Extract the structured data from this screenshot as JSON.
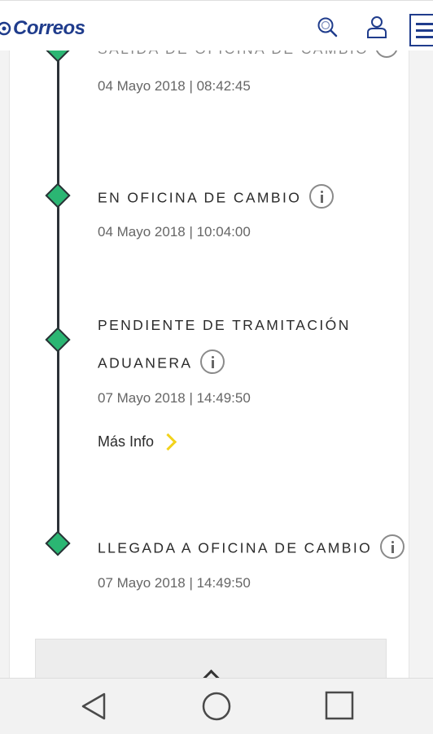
{
  "header": {
    "brand": "Correos",
    "brand_color": "#1f3c8c",
    "icons": [
      "search-icon",
      "user-icon",
      "menu-icon"
    ]
  },
  "timeline": {
    "line_color": "#2c3137",
    "node_color": "#2bb673",
    "partial_event": {
      "status": "SALIDA DE OFICINA DE CAMBIO",
      "date": "04 Mayo 2018 | 08:42:45"
    },
    "events": [
      {
        "status": "EN OFICINA DE CAMBIO",
        "date": "04 Mayo 2018 | 10:04:00"
      },
      {
        "status_line1": "PENDIENTE DE TRAMITACIÓN",
        "status_line2": "ADUANERA",
        "date": "07 Mayo 2018 | 14:49:50",
        "more_info": "Más Info",
        "more_info_color": "#f2d21b"
      },
      {
        "status": "LLEGADA A OFICINA DE CAMBIO",
        "date": "07 Mayo 2018 | 14:49:50"
      }
    ]
  },
  "collapse_panel": {
    "icon": "chevron-up-icon"
  },
  "android_nav": {
    "buttons": [
      "back-icon",
      "home-icon",
      "recents-icon"
    ]
  }
}
